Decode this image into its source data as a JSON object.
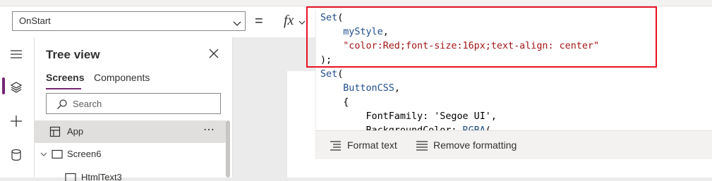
{
  "toolbar": {
    "property_value": "OnStart",
    "equals_sign": "=",
    "fx_label": "fx"
  },
  "rail": {
    "items": [
      "hamburger-menu",
      "tree-view-layers",
      "insert-plus",
      "data-cylinder"
    ]
  },
  "tree_view": {
    "title": "Tree view",
    "tabs": [
      {
        "label": "Screens",
        "active": true
      },
      {
        "label": "Components",
        "active": false
      }
    ],
    "search_placeholder": "Search",
    "items": [
      {
        "label": "App",
        "more": "⋯"
      },
      {
        "label": "Screen6"
      },
      {
        "label": "HtmlText3"
      }
    ]
  },
  "formula": {
    "lines": [
      [
        {
          "t": "fn",
          "v": "Set"
        },
        {
          "t": "p",
          "v": "("
        }
      ],
      [
        {
          "t": "p",
          "v": "    "
        },
        {
          "t": "id",
          "v": "myStyle"
        },
        {
          "t": "p",
          "v": ","
        }
      ],
      [
        {
          "t": "p",
          "v": "    "
        },
        {
          "t": "str",
          "v": "\"color:Red;font-size:16px;text-align: center\""
        }
      ],
      [
        {
          "t": "p",
          "v": ");"
        }
      ],
      [
        {
          "t": "fn",
          "v": "Set"
        },
        {
          "t": "p",
          "v": "("
        }
      ],
      [
        {
          "t": "p",
          "v": "    "
        },
        {
          "t": "id",
          "v": "ButtonCSS"
        },
        {
          "t": "p",
          "v": ","
        }
      ],
      [
        {
          "t": "p",
          "v": "    {"
        }
      ],
      [
        {
          "t": "p",
          "v": "        FontFamily: 'Segoe UI',"
        }
      ],
      [
        {
          "t": "p",
          "v": "        BackgroundColor: "
        },
        {
          "t": "fn",
          "v": "RGBA"
        },
        {
          "t": "p",
          "v": "("
        }
      ]
    ]
  },
  "editor_footer": {
    "format_text": "Format text",
    "remove_formatting": "Remove formatting"
  },
  "colors": {
    "accent": "#742774",
    "highlight": "#e81123",
    "function_token": "#1e4e8c",
    "string_token": "#a31515"
  }
}
